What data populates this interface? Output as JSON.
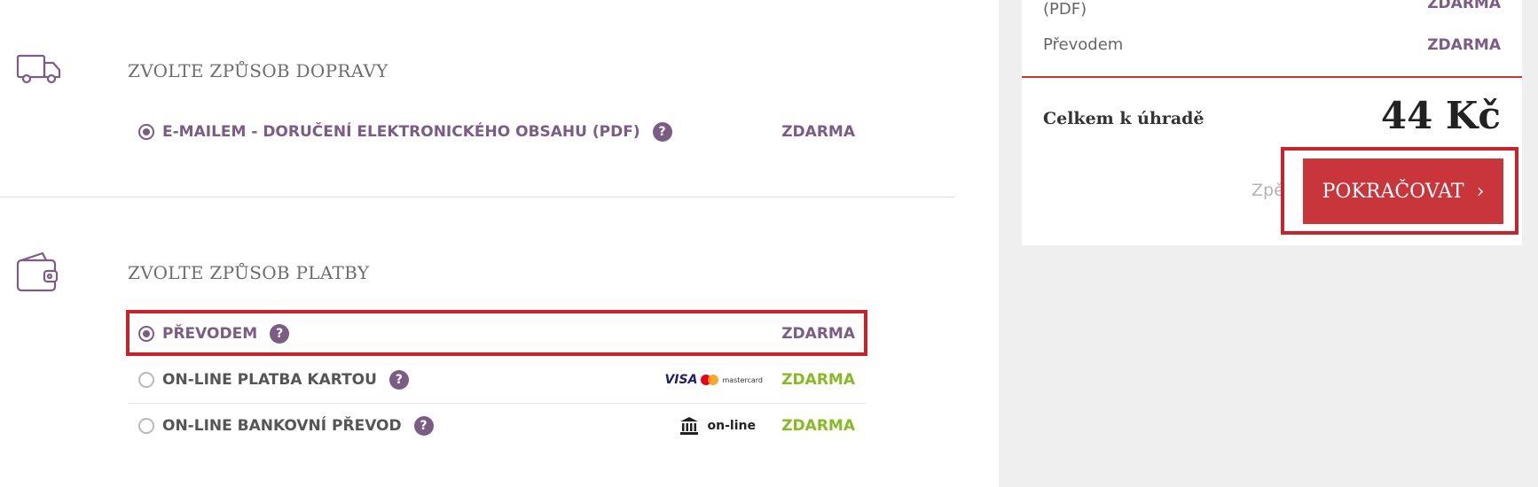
{
  "summary": {
    "pdf_label": "(PDF)",
    "pdf_price": "ZDARMA",
    "payment_label": "Převodem",
    "payment_price": "ZDARMA",
    "total_label": "Celkem k úhradě",
    "total_value": "44 Kč",
    "back_label": "Zpět",
    "continue_label": "POKRAČOVAT",
    "continue_chevron": "›"
  },
  "shipping": {
    "title": "ZVOLTE ZPŮSOB DOPRAVY",
    "icon": "truck-icon",
    "options": [
      {
        "label": "E-MAILEM - DORUČENÍ ELEKTRONICKÉHO OBSAHU (PDF)",
        "price": "ZDARMA",
        "selected": true
      }
    ]
  },
  "payment": {
    "title": "ZVOLTE ZPŮSOB PLATBY",
    "icon": "wallet-icon",
    "options": [
      {
        "label": "PŘEVODEM",
        "price": "ZDARMA",
        "selected": true
      },
      {
        "label": "ON-LINE PLATBA KARTOU",
        "price": "ZDARMA",
        "selected": false,
        "logo_text": "VISA",
        "logo_sub": "mastercard"
      },
      {
        "label": "ON-LINE BANKOVNÍ PŘEVOD",
        "price": "ZDARMA",
        "selected": false,
        "logo_text": "on-line"
      }
    ]
  },
  "help_glyph": "?",
  "colors": {
    "accent_purple": "#7a5c85",
    "accent_red": "#c8363b",
    "price_green": "#86bb25"
  }
}
